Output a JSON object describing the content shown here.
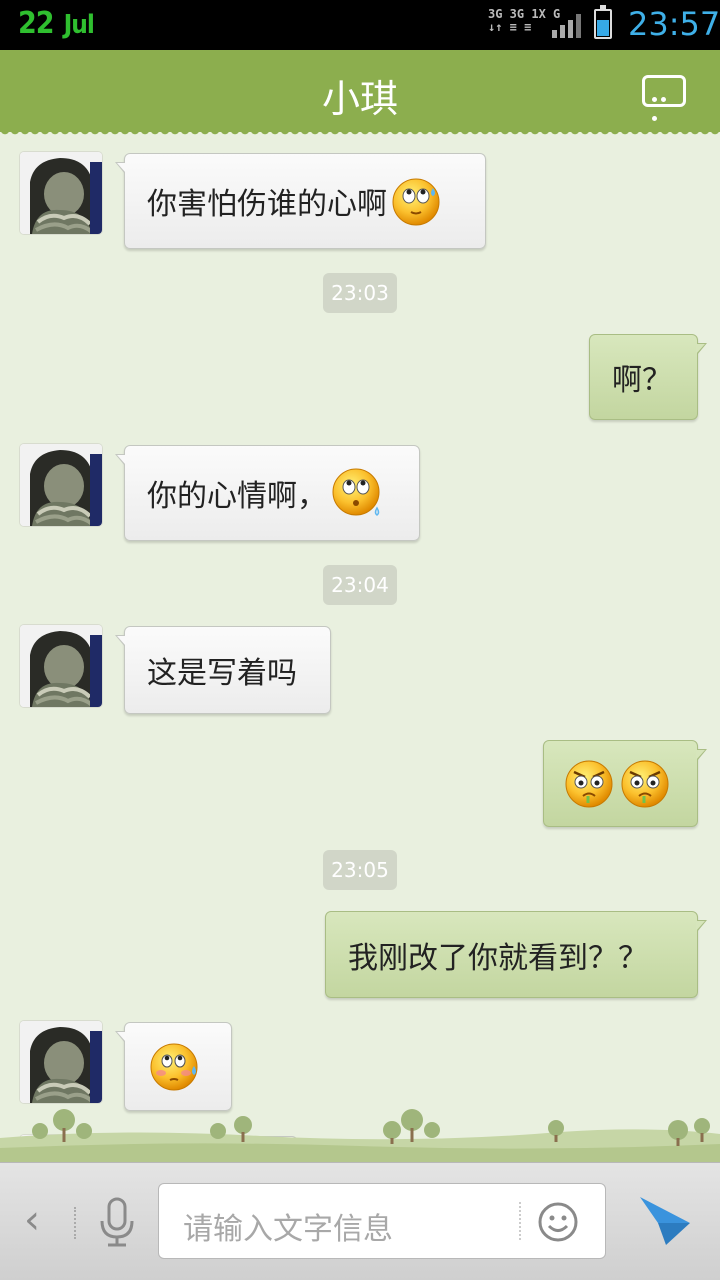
{
  "status_bar": {
    "date_day": "22",
    "date_month": "Jul",
    "network": [
      "3G 3G 1X G",
      "↓↑ ≡ ≡"
    ],
    "time": "23:57",
    "battery_level_percent": 60
  },
  "header": {
    "title": "小琪",
    "menu_icon": "more-dots-icon"
  },
  "messages": [
    {
      "side": "in",
      "text": "你害怕伤谁的心啊",
      "emoji": "sweat-eyes-up"
    },
    {
      "timestamp": "23:03"
    },
    {
      "side": "out",
      "text": "啊？"
    },
    {
      "side": "in",
      "text": "你的心情啊，",
      "emoji": "eyes-up-drop"
    },
    {
      "timestamp": "23:04"
    },
    {
      "side": "in",
      "text": "这是写着吗"
    },
    {
      "side": "out",
      "emojis": [
        "angry-drool",
        "angry-drool"
      ]
    },
    {
      "timestamp": "23:05"
    },
    {
      "side": "out",
      "text": "我刚改了你就看到？？"
    },
    {
      "side": "in",
      "emoji": "blush-sweat"
    }
  ],
  "input_bar": {
    "back_icon": "chevron-left-icon",
    "mic_icon": "microphone-icon",
    "placeholder": "请输入文字信息",
    "emoji_icon": "smiley-icon",
    "send_icon": "send-icon"
  },
  "colors": {
    "title_bar": "#8cae4e",
    "background": "#e9f0df",
    "outgoing_bubble": "#c9daa8",
    "incoming_bubble": "#f4f4f4",
    "time_accent": "#3fb0e8"
  }
}
